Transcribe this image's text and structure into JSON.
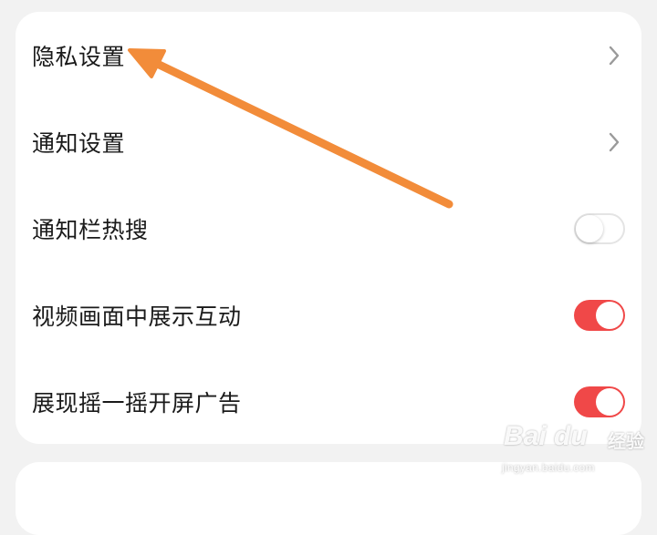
{
  "settings": {
    "items": [
      {
        "label": "隐私设置",
        "control": "chevron"
      },
      {
        "label": "通知设置",
        "control": "chevron"
      },
      {
        "label": "通知栏热搜",
        "control": "toggle",
        "enabled": false
      },
      {
        "label": "视频画面中展示互动",
        "control": "toggle",
        "enabled": true
      },
      {
        "label": "展现摇一摇开屏广告",
        "control": "toggle",
        "enabled": true
      }
    ]
  },
  "annotation": {
    "color": "#f28c3a",
    "icon": "arrow-pointer"
  },
  "colors": {
    "toggle_on": "#f04848",
    "toggle_off_border": "#e4e4e4",
    "background": "#f2f2f2",
    "card": "#ffffff",
    "chevron": "#9a9a9a"
  },
  "watermark": {
    "logo": "Bai du",
    "sub": "经验",
    "url": "jingyan.baidu.com"
  }
}
